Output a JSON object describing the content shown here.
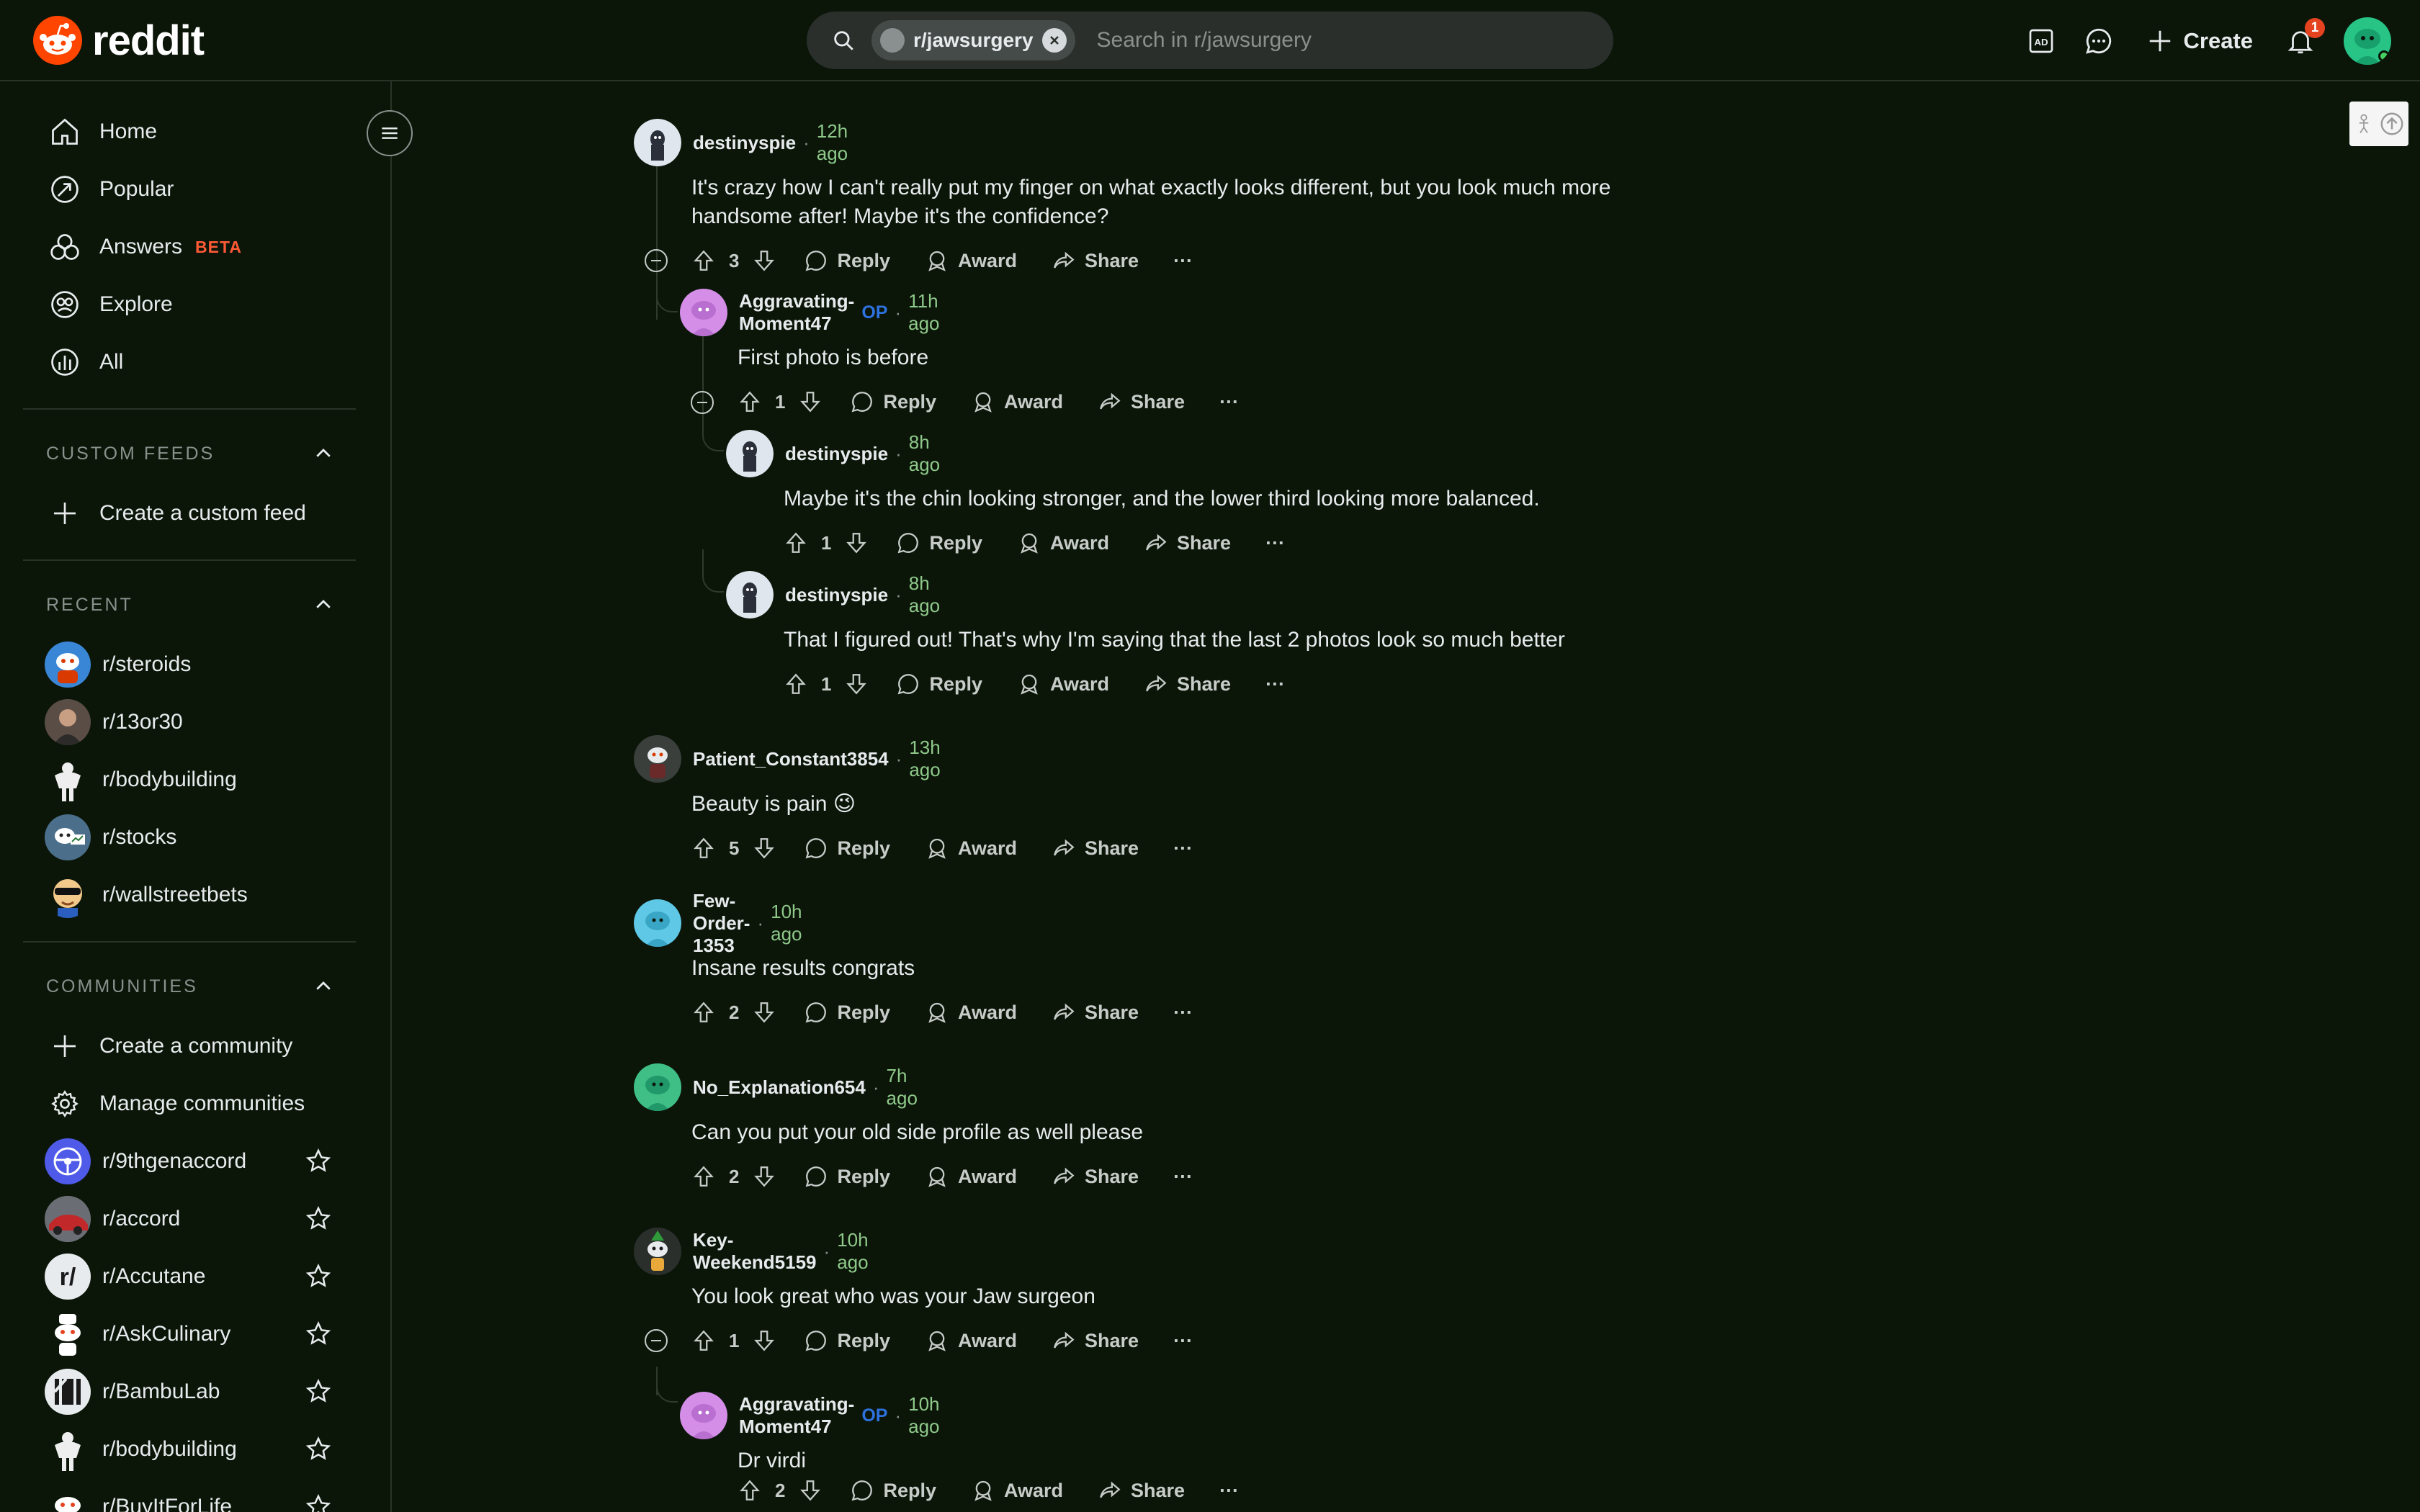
{
  "header": {
    "logo_text": "reddit",
    "search_chip": "r/jawsurgery",
    "search_placeholder": "Search in r/jawsurgery",
    "create_label": "Create",
    "notification_count": "1"
  },
  "sidebar": {
    "nav": [
      {
        "label": "Home",
        "icon": "home-icon"
      },
      {
        "label": "Popular",
        "icon": "popular-icon"
      },
      {
        "label": "Answers",
        "badge": "BETA",
        "icon": "answers-icon"
      },
      {
        "label": "Explore",
        "icon": "explore-icon"
      },
      {
        "label": "All",
        "icon": "all-icon"
      }
    ],
    "custom_feeds": {
      "title": "CUSTOM FEEDS",
      "create_label": "Create a custom feed"
    },
    "recent": {
      "title": "RECENT",
      "items": [
        "r/steroids",
        "r/13or30",
        "r/bodybuilding",
        "r/stocks",
        "r/wallstreetbets"
      ]
    },
    "communities": {
      "title": "COMMUNITIES",
      "create_label": "Create a community",
      "manage_label": "Manage communities",
      "items": [
        "r/9thgenaccord",
        "r/accord",
        "r/Accutane",
        "r/AskCulinary",
        "r/BambuLab",
        "r/bodybuilding",
        "r/BuyItForLife"
      ]
    }
  },
  "comments": [
    {
      "author": "destinyspie",
      "op": "",
      "time": "12h ago",
      "body": "It's crazy how I can't really put my finger on what exactly looks different, but you look much more handsome after! Maybe it's the confidence?",
      "votes": "3"
    },
    {
      "author": "Aggravating-Moment47",
      "op": "OP",
      "time": "11h ago",
      "body": "First photo is before",
      "votes": "1"
    },
    {
      "author": "destinyspie",
      "op": "",
      "time": "8h ago",
      "body": "Maybe it's the chin looking stronger, and the lower third looking more balanced.",
      "votes": "1"
    },
    {
      "author": "destinyspie",
      "op": "",
      "time": "8h ago",
      "body": "That I figured out! That's why I'm saying that the last 2 photos look so much better",
      "votes": "1"
    },
    {
      "author": "Patient_Constant3854",
      "op": "",
      "time": "13h ago",
      "body": "Beauty is pain 😉",
      "votes": "5"
    },
    {
      "author": "Few-Order-1353",
      "op": "",
      "time": "10h ago",
      "body": "Insane results congrats",
      "votes": "2"
    },
    {
      "author": "No_Explanation654",
      "op": "",
      "time": "7h ago",
      "body": "Can you put your old side profile as well please",
      "votes": "2"
    },
    {
      "author": "Key-Weekend5159",
      "op": "",
      "time": "10h ago",
      "body": "You look great who was your Jaw surgeon",
      "votes": "1"
    },
    {
      "author": "Aggravating-Moment47",
      "op": "OP",
      "time": "10h ago",
      "body": "Dr virdi",
      "votes": "2"
    }
  ],
  "actions": {
    "reply": "Reply",
    "award": "Award",
    "share": "Share",
    "more": "···"
  },
  "colors": {
    "background": "#0b1609",
    "time": "#8fc98a",
    "op": "#2e72e0",
    "brand": "#ff4500",
    "beta": "#ff5a36"
  }
}
